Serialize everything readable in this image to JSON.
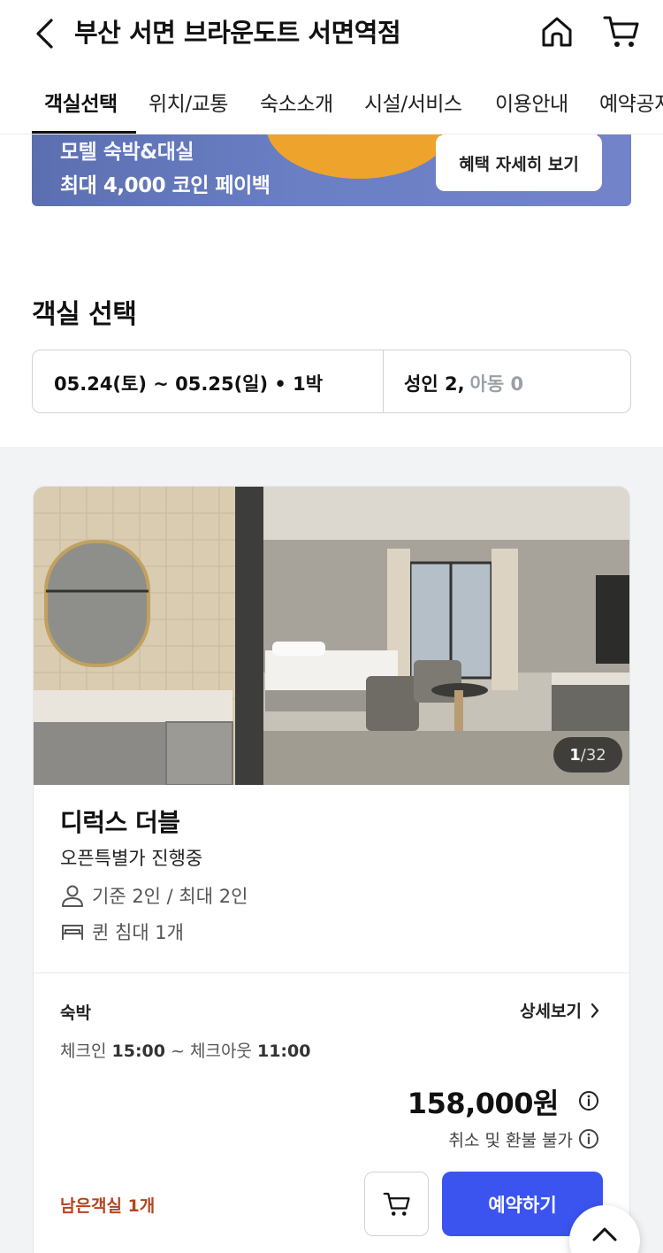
{
  "header": {
    "title": "부산 서면 브라운도트 서면역점"
  },
  "tabs": [
    {
      "label": "객실선택",
      "active": true
    },
    {
      "label": "위치/교통"
    },
    {
      "label": "숙소소개"
    },
    {
      "label": "시설/서비스"
    },
    {
      "label": "이용안내"
    },
    {
      "label": "예약공지"
    }
  ],
  "banner": {
    "line1": "모텔 숙박&대실",
    "line2": "최대 4,000 코인 페이백",
    "button_label": "혜택 자세히 보기"
  },
  "room_selection": {
    "title": "객실 선택",
    "date_range": "05.24(토) ~ 05.25(일) • 1박",
    "adults": "성인 2,",
    "children": "아동 0"
  },
  "room_card": {
    "photo_counter_current": "1",
    "photo_counter_total": "/32",
    "name": "디럭스 더블",
    "promo": "오픈특별가 진행중",
    "capacity": "기준 2인 / 최대 2인",
    "bed": "퀸 침대 1개",
    "stay_type": "숙박",
    "detail_link": "상세보기",
    "checkin_label": "체크인",
    "checkin_time": "15:00",
    "checkout_label": "~ 체크아웃",
    "checkout_time": "11:00",
    "price": "158,000원",
    "refund_policy": "취소 및 환불 불가",
    "remaining": "남은객실 1개",
    "reserve_label": "예약하기"
  },
  "colors": {
    "primary": "#3b54f0",
    "remaining_text": "#b5441f",
    "banner_bg": "#6a7fc4"
  },
  "icons": [
    "back-arrow-icon",
    "home-icon",
    "cart-icon",
    "person-icon",
    "bed-icon",
    "chevron-right-icon",
    "info-icon",
    "chevron-up-icon"
  ]
}
